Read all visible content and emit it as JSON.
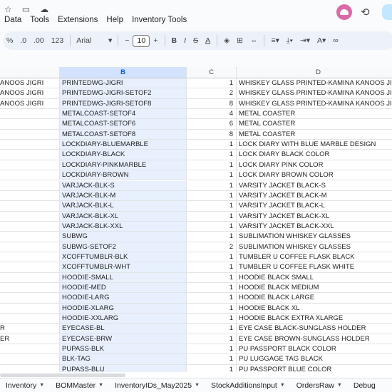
{
  "menu": [
    "Data",
    "Tools",
    "Extensions",
    "Help",
    "Inventory Tools"
  ],
  "toolbar": {
    "percent": "%",
    "dec_decrease": ".0",
    "dec_increase": ".00",
    "number_format": "123",
    "font": "Arial",
    "font_size": "10",
    "minus": "−",
    "plus": "+",
    "bold": "B",
    "italic": "I",
    "strike": "S",
    "text_color": "A"
  },
  "columns": {
    "b": "B",
    "c": "C",
    "d": "D"
  },
  "rows": [
    {
      "a": "ANOOS JIGRI",
      "b": "PRINTEDWG-JIGRI",
      "c": "1",
      "d": "WHISKEY GLASS PRINTED-KAMINA KANOOS JIGRI"
    },
    {
      "a": "ANOOS JIGRI",
      "b": "PRINTEDWG-JIGRI-SETOF2",
      "c": "2",
      "d": "WHISKEY GLASS PRINTED-KAMINA KANOOS JIGRI"
    },
    {
      "a": "ANOOS JIGRI",
      "b": "PRINTEDWG-JIGRI-SETOF8",
      "c": "8",
      "d": "WHISKEY GLASS PRINTED-KAMINA KANOOS JIGRI"
    },
    {
      "a": "",
      "b": "METALCOAST-SETOF4",
      "c": "4",
      "d": "METAL COASTER"
    },
    {
      "a": "",
      "b": "METALCOAST-SETOF6",
      "c": "6",
      "d": "METAL COASTER"
    },
    {
      "a": "",
      "b": "METALCOAST-SETOF8",
      "c": "8",
      "d": "METAL COASTER"
    },
    {
      "a": "",
      "b": "LOCKDIARY-BLUEMARBLE",
      "c": "1",
      "d": "LOCK DIARY WITH BLUE MARBLE DESIGN"
    },
    {
      "a": "",
      "b": "LOCKDIARY-BLACK",
      "c": "1",
      "d": "LOCK DIARY BLACK COLOR"
    },
    {
      "a": "",
      "b": "LOCKDIARY-PINKMARBLE",
      "c": "1",
      "d": "LOCK DIARY PINK COLOR"
    },
    {
      "a": "",
      "b": "LOCKDIARY-BROWN",
      "c": "1",
      "d": "LOCK DIARY BROWN COLOR"
    },
    {
      "a": "",
      "b": "VARJACK-BLK-S",
      "c": "1",
      "d": "VARSITY JACKET BLACK-S"
    },
    {
      "a": "",
      "b": "VARJACK-BLK-M",
      "c": "1",
      "d": "VARSITY JACKET BLACK-M"
    },
    {
      "a": "",
      "b": "VARJACK-BLK-L",
      "c": "1",
      "d": "VARSITY JACKET BLACK-L"
    },
    {
      "a": "",
      "b": "VARJACK-BLK-XL",
      "c": "1",
      "d": "VARSITY JACKET BLACK-XL"
    },
    {
      "a": "",
      "b": "VARJACK-BLK-XXL",
      "c": "1",
      "d": "VARSITY JACKET BLACK-XXL"
    },
    {
      "a": "",
      "b": "SUBWG",
      "c": "1",
      "d": "SUBLIMATION WHISKEY GLASSES"
    },
    {
      "a": "",
      "b": "SUBWG-SETOF2",
      "c": "2",
      "d": "SUBLIMATION WHISKEY GLASSES"
    },
    {
      "a": "",
      "b": "XCOFFTUMBLR-BLK",
      "c": "1",
      "d": "TUMBLER U COFFEE FLASK BLACK"
    },
    {
      "a": "",
      "b": "XCOFFTUMBLR-WHT",
      "c": "1",
      "d": "TUMBLER U COFFEE FLASK WHITE"
    },
    {
      "a": "",
      "b": "HOODIE-SMALL",
      "c": "1",
      "d": "HOODIE BLACK SMALL"
    },
    {
      "a": "",
      "b": "HOODIE-MED",
      "c": "1",
      "d": "HOODIE BLACK MEDIUM"
    },
    {
      "a": "",
      "b": "HOODIE-LARG",
      "c": "1",
      "d": "HOODIE BLACK LARGE"
    },
    {
      "a": "",
      "b": "HOODIE-XLARG",
      "c": "1",
      "d": "HOODIE BLACK XL"
    },
    {
      "a": "",
      "b": "HOODIE-XXLARG",
      "c": "1",
      "d": "HOODIE BLACK EXTRA XLARGE"
    },
    {
      "a": "R",
      "b": "EYECASE-BL",
      "c": "1",
      "d": "EYE CASE BLACK-SUNGLASS HOLDER"
    },
    {
      "a": "ER",
      "b": "EYECASE-BRW",
      "c": "1",
      "d": "EYE CASE BROWN-SUNGLASS HOLDER"
    },
    {
      "a": "",
      "b": "PUPASS-BLK",
      "c": "1",
      "d": "PU PASSPORT BLACK COLOR"
    },
    {
      "a": "",
      "b": "BLK-TAG",
      "c": "1",
      "d": "PU LUGGAGE TAG BLACK"
    },
    {
      "a": "",
      "b": "PUPASS-BLU",
      "c": "1",
      "d": "PU PASSPORT BLUE COLOR"
    }
  ],
  "tabs": [
    "Inventory",
    "BOMMaster",
    "InventoryIDs_May2025",
    "StockAdditionsInput",
    "OrdersRaw",
    "Debug"
  ]
}
